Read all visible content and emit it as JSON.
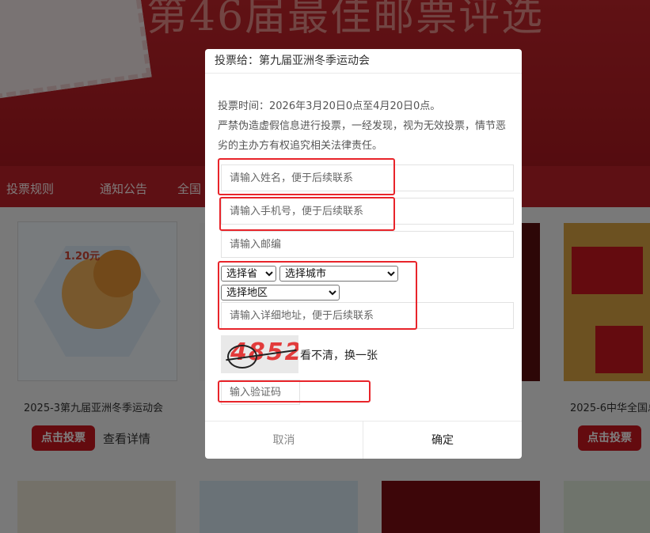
{
  "banner": {
    "title": "第46届最佳邮票评选"
  },
  "nav": {
    "items": [
      "投票规则",
      "通知公告",
      "全国"
    ]
  },
  "cards": [
    {
      "title": "2025-3第九届亚洲冬季运动会",
      "price": "1.20元",
      "vote_label": "点击投票",
      "detail_label": "查看详情"
    },
    {
      "title": "2025-6中华全国总",
      "vote_label": "点击投票"
    }
  ],
  "modal": {
    "title": "投票给：第九届亚洲冬季运动会",
    "notice_time": "投票时间：2026年3月20日0点至4月20日0点。",
    "notice_warning": "严禁伪造虚假信息进行投票，一经发现，视为无效投票，情节恶劣的主办方有权追究相关法律责任。",
    "name_placeholder": "请输入姓名，便于后续联系",
    "phone_placeholder": "请输入手机号，便于后续联系",
    "postcode_placeholder": "请输入邮编",
    "province_selected": "选择省",
    "city_selected": "选择城市",
    "district_selected": "选择地区",
    "address_placeholder": "请输入详细地址，便于后续联系",
    "captcha_text": "4852",
    "refresh_label": "看不清，换一张",
    "code_placeholder": "输入验证码",
    "cancel_label": "取消",
    "confirm_label": "确定"
  },
  "colors": {
    "brand_red": "#c8161e",
    "highlight_red": "#e8242a"
  }
}
